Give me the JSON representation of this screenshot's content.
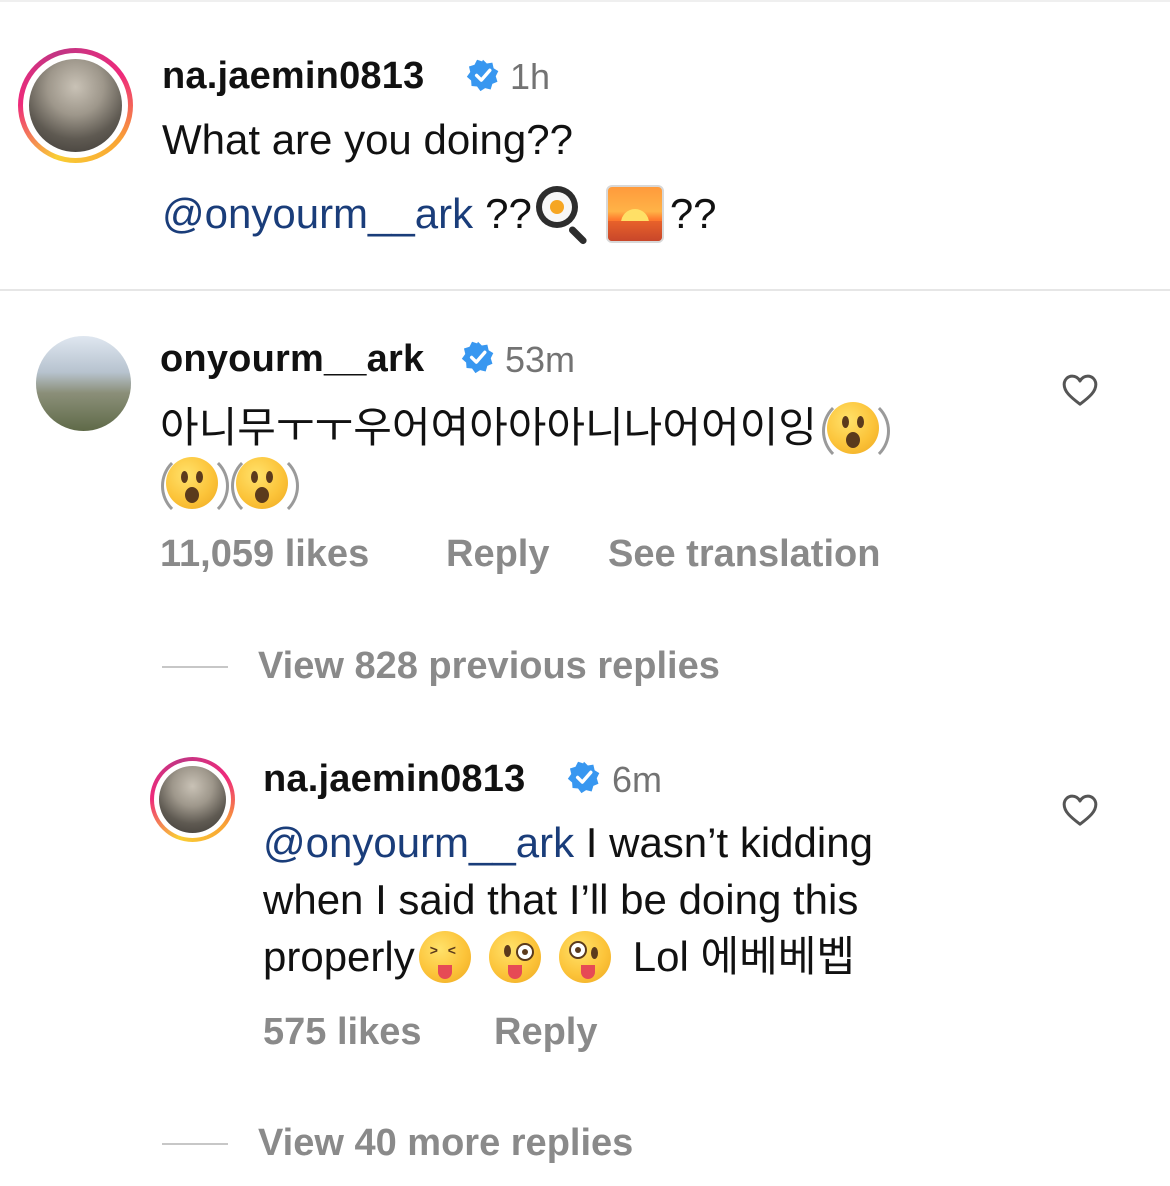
{
  "comment_main": {
    "username": "na.jaemin0813",
    "time": "1h",
    "line1": "What are you doing??",
    "mention": "@onyourm__ark",
    "line2_a": "??",
    "line2_b": "??"
  },
  "comment_reply1": {
    "username": "onyourm__ark",
    "time": "53m",
    "text": "아니무ㅜㅜ우어여아아아니나어어이잉",
    "likes": "11,059 likes",
    "reply_label": "Reply",
    "translate_label": "See translation"
  },
  "view_previous": "View 828 previous replies",
  "comment_reply2": {
    "username": "na.jaemin0813",
    "time": "6m",
    "mention": "@onyourm__ark",
    "line1_rest": " I wasn’t kidding",
    "line2": "when I said that I’ll be doing this",
    "line3_a": "properly",
    "line3_b": "Lol 에베베벱",
    "likes": "575 likes",
    "reply_label": "Reply"
  },
  "view_more": "View 40 more replies",
  "colors": {
    "verified": "#3897f0",
    "mention": "#1a3d7a",
    "muted": "#8a8a8a"
  },
  "icons": [
    "verified-badge-icon",
    "heart-icon",
    "frying-pan-egg-emoji",
    "sunrise-emoji",
    "astonished-face-emoji",
    "squinting-tongue-emoji",
    "winking-tongue-emoji",
    "zany-face-emoji"
  ]
}
